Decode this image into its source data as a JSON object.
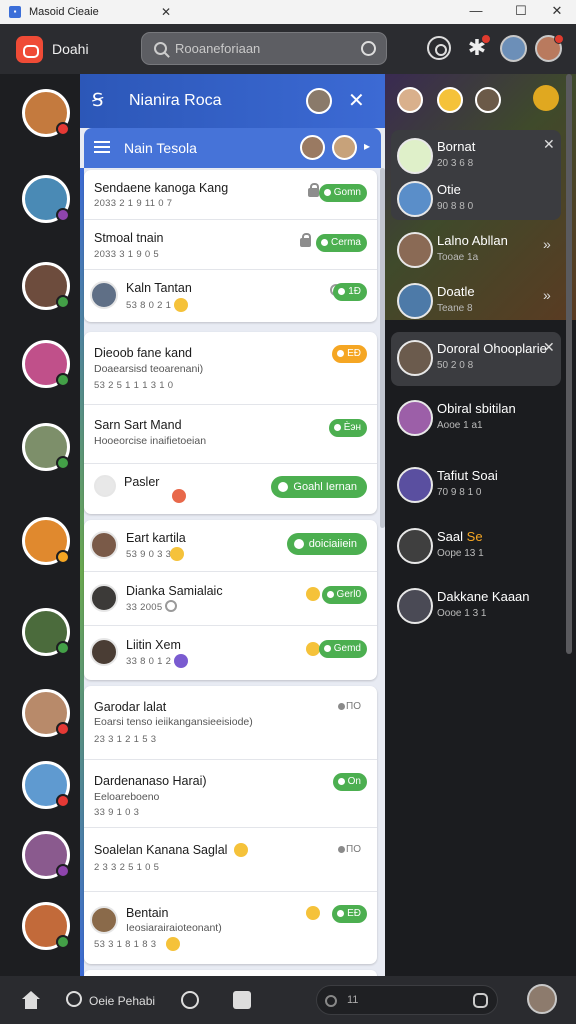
{
  "window": {
    "title": "Masoid Cieaie",
    "minimize": "—",
    "maximize": "☐",
    "close": "✕",
    "tab_close": "✕"
  },
  "appbar": {
    "brand": "Doahi",
    "search_placeholder": "Rooaneforiaan"
  },
  "modal": {
    "logo": "Ꞩ",
    "title": "Nianira Roca",
    "close": "✕",
    "subtitle": "Nain Tesola",
    "subtitle_arrow": "▸"
  },
  "chats": [
    {
      "name": "Sendaene kanoga Kang",
      "time": "2033 2 1 9 11 0 7",
      "action": "Gomn"
    },
    {
      "name": "Stmoal tnain",
      "time": "2033 3 1 9 0 5",
      "action": "Cerma"
    },
    {
      "name": "Kaln Tantan",
      "time": "53 8 0 2 1",
      "action": "1Ð"
    },
    {
      "name": "Dieoob fane kand",
      "sub": "Doaearsisd teoarenani)",
      "time": "53 2 5 1 1 1 3 1 0",
      "action": "EÐ"
    },
    {
      "name": "Sarn Sart Mand",
      "sub": "Hooeorcise inaifietoeian",
      "action": "Ѐэн"
    },
    {
      "name": "Pasler",
      "action": "Goahl Iernan"
    },
    {
      "name": "Eart kartila",
      "time": "53 9 0 3 3",
      "action": "doiciaiiein"
    },
    {
      "name": "Dianka Samialaic",
      "time": "33 2005",
      "action": "Gerl0"
    },
    {
      "name": "Liitin Xem",
      "time": "33 8 0 1 2",
      "action": "Gemd"
    },
    {
      "name": "Garodar lalat",
      "sub": "Eoarsi tenso ieiikangansieeisiode)",
      "time": "23 3 1 2 1 5 3",
      "action": "ПО"
    },
    {
      "name": "Dardenanaso Harai)",
      "sub": "Eeloareboeno",
      "time": "33 9 1 0 3",
      "action": "Оn"
    },
    {
      "name": "Soalelan Kanana Saglal",
      "time": "2 3 3 2 5 1 0 5",
      "action": "ПО"
    },
    {
      "name": "Bentain",
      "sub": "Ieosiarairaioteonant)",
      "time": "53 3 1 8 1 8 3",
      "action": "EÐ"
    }
  ],
  "right_panel": [
    {
      "name": "Bornat",
      "time": "20 3 6 8"
    },
    {
      "name": "Otie",
      "time": "90 8 8 0"
    },
    {
      "name": "Lalno Abllan",
      "time": "Tooae 1a"
    },
    {
      "name": "Doatle",
      "time": "Teane 8"
    },
    {
      "name": "Dororal Ohooplarie",
      "time": "50 2 0 8"
    },
    {
      "name": "Obiral sbitilan",
      "time": "Aooe 1 a1"
    },
    {
      "name": "Tafiut Soai",
      "time": "70 9 8 1 0"
    },
    {
      "name": "Saal",
      "name_accent": "Se",
      "time": "Oope 13 1"
    },
    {
      "name": "Dakkane Kaaan",
      "time": "Oooe 1 3 1"
    }
  ],
  "right_panel_arrows": {
    "lalno": "»",
    "doatle": "»"
  },
  "bottom": {
    "label": "Oeie Pehabi",
    "search_text": "11"
  },
  "colors": {
    "accent_blue": "#3c6ad4",
    "green": "#4caf50",
    "orange": "#f5a623",
    "logo_red": "#ef4b36"
  }
}
